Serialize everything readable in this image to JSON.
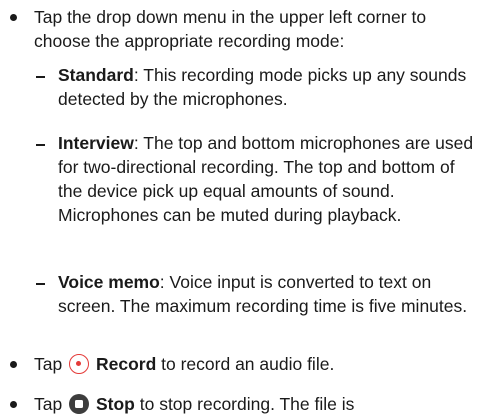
{
  "bullets": {
    "mode_intro": "Tap the drop down menu in the upper left corner to choose the appropriate recording mode:",
    "record_prefix": "Tap",
    "record_label": "Record",
    "record_suffix": "to record an audio file.",
    "stop_prefix": "Tap",
    "stop_label": "Stop",
    "stop_suffix": "to stop recording. The file is"
  },
  "modes": [
    {
      "name": "Standard",
      "description": ": This recording mode picks up any sounds detected by the microphones."
    },
    {
      "name": "Interview",
      "description": ": The top and bottom microphones are used for two-directional recording. The top and bottom of the device pick up equal amounts of sound. Microphones can be muted during playback."
    },
    {
      "name": "Voice memo",
      "description": ": Voice input is converted to text on screen. The maximum recording time is five minutes."
    }
  ],
  "icons": {
    "record": "record-icon",
    "stop": "stop-icon",
    "record_color": "#e43a38",
    "stop_color": "#3d3d3d"
  }
}
